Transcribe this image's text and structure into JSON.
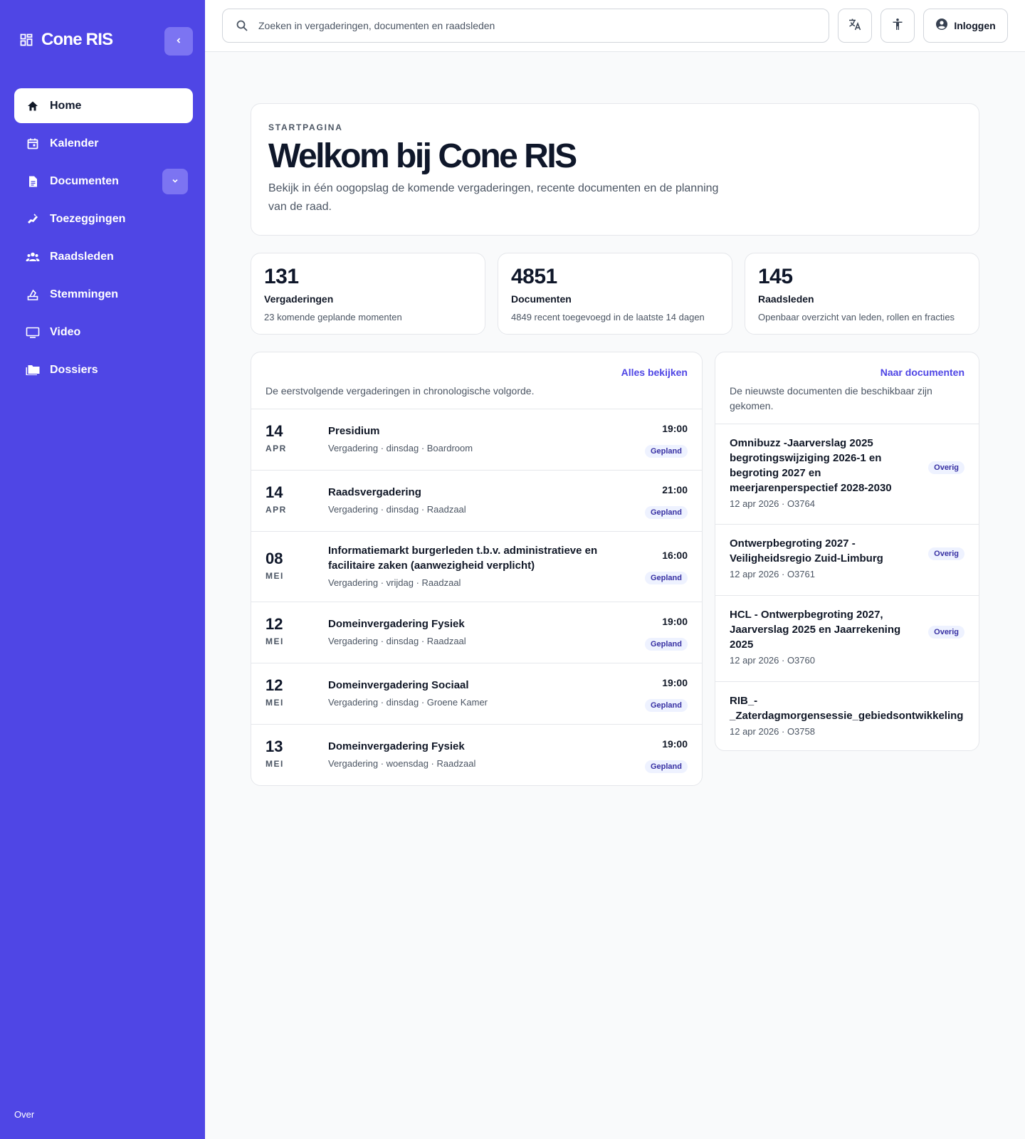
{
  "brand": {
    "name": "Cone RIS"
  },
  "sidebar": {
    "items": [
      {
        "label": "Home",
        "icon": "home-icon",
        "active": true
      },
      {
        "label": "Kalender",
        "icon": "calendar-icon"
      },
      {
        "label": "Documenten",
        "icon": "document-icon",
        "expandable": true
      },
      {
        "label": "Toezeggingen",
        "icon": "handshake-icon"
      },
      {
        "label": "Raadsleden",
        "icon": "people-icon"
      },
      {
        "label": "Stemmingen",
        "icon": "ballot-icon"
      },
      {
        "label": "Video",
        "icon": "monitor-icon"
      },
      {
        "label": "Dossiers",
        "icon": "folders-icon"
      }
    ],
    "footer_link": "Over"
  },
  "topbar": {
    "search_placeholder": "Zoeken in vergaderingen, documenten en raadsleden",
    "login_label": "Inloggen"
  },
  "hero": {
    "eyebrow": "STARTPAGINA",
    "title": "Welkom bij Cone RIS",
    "description": "Bekijk in één oogopslag de komende vergaderingen, recente documenten en de planning van de raad."
  },
  "stats": [
    {
      "value": "131",
      "title": "Vergaderingen",
      "sub": "23 komende geplande momenten"
    },
    {
      "value": "4851",
      "title": "Documenten",
      "sub": "4849 recent toegevoegd in de laatste 14 dagen"
    },
    {
      "value": "145",
      "title": "Raadsleden",
      "sub": "Openbaar overzicht van leden, rollen en fracties"
    }
  ],
  "meetings": {
    "link": "Alles bekijken",
    "description": "De eerstvolgende vergaderingen in chronologische volgorde.",
    "rows": [
      {
        "day": "14",
        "month": "APR",
        "title": "Presidium",
        "meta": "Vergadering · dinsdag · Boardroom",
        "time": "19:00",
        "status": "Gepland"
      },
      {
        "day": "14",
        "month": "APR",
        "title": "Raadsvergadering",
        "meta": "Vergadering · dinsdag · Raadzaal",
        "time": "21:00",
        "status": "Gepland"
      },
      {
        "day": "08",
        "month": "MEI",
        "title": "Informatiemarkt burgerleden t.b.v. administratieve en facilitaire zaken (aanwezigheid verplicht)",
        "meta": "Vergadering · vrijdag · Raadzaal",
        "time": "16:00",
        "status": "Gepland"
      },
      {
        "day": "12",
        "month": "MEI",
        "title": "Domeinvergadering Fysiek",
        "meta": "Vergadering · dinsdag · Raadzaal",
        "time": "19:00",
        "status": "Gepland"
      },
      {
        "day": "12",
        "month": "MEI",
        "title": "Domeinvergadering Sociaal",
        "meta": "Vergadering · dinsdag · Groene Kamer",
        "time": "19:00",
        "status": "Gepland"
      },
      {
        "day": "13",
        "month": "MEI",
        "title": "Domeinvergadering Fysiek",
        "meta": "Vergadering · woensdag · Raadzaal",
        "time": "19:00",
        "status": "Gepland"
      }
    ]
  },
  "documents": {
    "link": "Naar documenten",
    "description": "De nieuwste documenten die beschikbaar zijn gekomen.",
    "rows": [
      {
        "title": "Omnibuzz -Jaarverslag 2025 begrotingswijziging 2026-1 en begroting 2027 en meerjarenperspectief 2028-2030",
        "meta": "12 apr 2026 · O3764",
        "category": "Overig"
      },
      {
        "title": "Ontwerpbegroting 2027 - Veiligheidsregio Zuid-Limburg",
        "meta": "12 apr 2026 · O3761",
        "category": "Overig"
      },
      {
        "title": "HCL - Ontwerpbegroting 2027, Jaarverslag 2025 en Jaarrekening 2025",
        "meta": "12 apr 2026 · O3760",
        "category": "Overig"
      },
      {
        "title": "RIB_-_Zaterdagmorgensessie_gebiedsontwikkeling",
        "meta": "12 apr 2026 · O3758",
        "category": ""
      }
    ]
  }
}
